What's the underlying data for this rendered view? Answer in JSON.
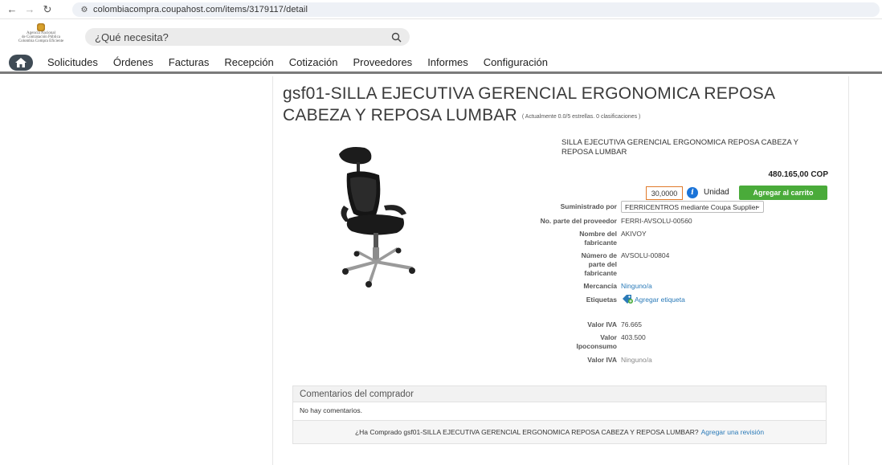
{
  "browser": {
    "url": "colombiacompra.coupahost.com/items/3179117/detail"
  },
  "header": {
    "logo_lines": [
      "Agencia Nacional",
      "de Contratación Pública",
      "Colombia Compra Eficiente"
    ],
    "search_placeholder": "¿Qué necesita?"
  },
  "nav": {
    "items": [
      "Solicitudes",
      "Órdenes",
      "Facturas",
      "Recepción",
      "Cotización",
      "Proveedores",
      "Informes",
      "Configuración"
    ]
  },
  "item": {
    "title": "gsf01-SILLA EJECUTIVA GERENCIAL ERGONOMICA REPOSA CABEZA Y REPOSA LUMBAR",
    "rating_text": "( Actualmente 0.0/5 estrellas. 0 clasificaciones )",
    "description": "SILLA EJECUTIVA GERENCIAL ERGONOMICA REPOSA CABEZA Y REPOSA LUMBAR",
    "price": "480.165,00 COP",
    "quantity": "30,0000",
    "unit": "Unidad",
    "add_to_cart": "Agregar al carrito",
    "supplied_by_label": "Suministrado por",
    "supplied_by_value": "FERRICENTROS mediante Coupa Supplier",
    "supplier_part_label": "No. parte del proveedor",
    "supplier_part_value": "FERRI-AVSOLU-00560",
    "manufacturer_label_1": "Nombre del",
    "manufacturer_label_2": "fabricante",
    "manufacturer_value": "AKIVOY",
    "mfr_part_label_1": "Número de",
    "mfr_part_label_2": "parte del",
    "mfr_part_label_3": "fabricante",
    "mfr_part_value": "AVSOLU-00804",
    "commodity_label": "Mercancía",
    "commodity_value": "Ninguno/a",
    "tags_label": "Etiquetas",
    "tags_link": "Agregar etiqueta",
    "iva_label": "Valor IVA",
    "iva_value": "76.665",
    "ipoconsumo_label_1": "Valor",
    "ipoconsumo_label_2": "Ipoconsumo",
    "ipoconsumo_value": "403.500",
    "iva2_label": "Valor IVA",
    "iva2_value": "Ninguno/a"
  },
  "comments": {
    "header": "Comentarios del comprador",
    "empty": "No hay comentarios.",
    "review_prompt": "¿Ha Comprado gsf01-SILLA EJECUTIVA GERENCIAL ERGONOMICA REPOSA CABEZA Y REPOSA LUMBAR?",
    "review_link": "Agregar una revisión"
  },
  "colors": {
    "accent_green": "#4aab3a",
    "link_blue": "#2a7ab8",
    "qty_border": "#e07a2b"
  }
}
